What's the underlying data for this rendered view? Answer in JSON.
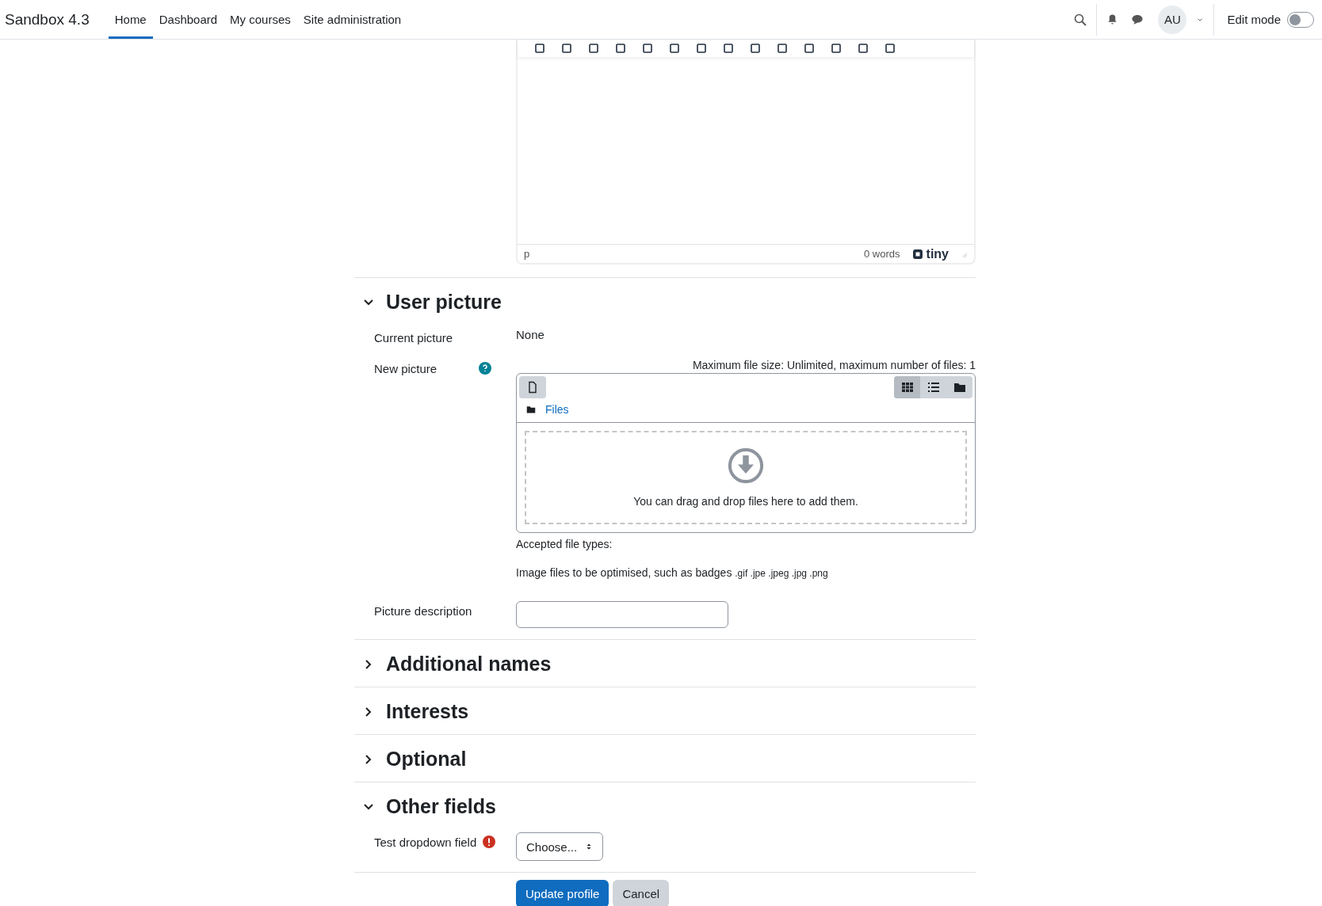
{
  "navbar": {
    "brand": "Sandbox 4.3",
    "links": [
      {
        "label": "Home",
        "selected": true
      },
      {
        "label": "Dashboard",
        "selected": false
      },
      {
        "label": "My courses",
        "selected": false
      },
      {
        "label": "Site administration",
        "selected": false
      }
    ],
    "avatar": "AU",
    "edit_mode": {
      "label": "Edit mode",
      "on": false
    }
  },
  "editor": {
    "element_path": "p",
    "word_count": "0 words",
    "logo": "tiny"
  },
  "sections": [
    {
      "title": "User picture",
      "expanded": true,
      "fields": [
        {
          "kind": "static",
          "label": "Current picture",
          "value": "None"
        },
        {
          "kind": "filepicker",
          "label": "New picture",
          "help": true,
          "max_size": "Maximum file size: Unlimited, maximum number of files: 1",
          "breadcrumb": "Files",
          "drop_text": "You can drag and drop files here to add them.",
          "accepted_label": "Accepted file types:",
          "accepted_desc": "Image files to be optimised, such as badges",
          "accepted_exts": ".gif .jpe .jpeg .jpg .png"
        },
        {
          "kind": "text",
          "label": "Picture description"
        }
      ]
    },
    {
      "title": "Additional names",
      "expanded": false
    },
    {
      "title": "Interests",
      "expanded": false
    },
    {
      "title": "Optional",
      "expanded": false
    },
    {
      "title": "Other fields",
      "expanded": true,
      "fields": [
        {
          "kind": "select",
          "label": "Test dropdown field",
          "required": true,
          "value": "Choose..."
        }
      ]
    }
  ],
  "buttons": [
    {
      "label": "Update profile",
      "kind": "primary"
    },
    {
      "label": "Cancel",
      "kind": "secondary"
    }
  ]
}
